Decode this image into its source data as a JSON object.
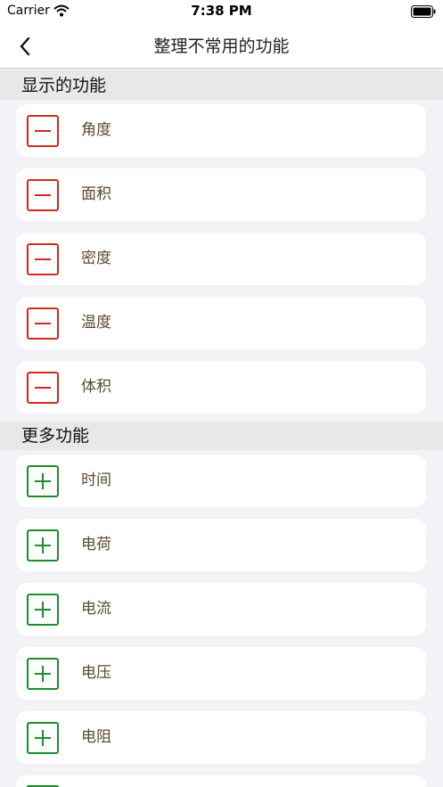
{
  "status_bar": {
    "carrier": "Carrier",
    "time": "7:38 PM",
    "icons": [
      "wifi-icon",
      "battery-icon"
    ]
  },
  "nav": {
    "title": "整理不常用的功能",
    "back_icon": "chevron-left-icon"
  },
  "sections": [
    {
      "title": "显示的功能",
      "icon": "minus-icon",
      "items": [
        {
          "label": "角度"
        },
        {
          "label": "面积"
        },
        {
          "label": "密度"
        },
        {
          "label": "温度"
        },
        {
          "label": "体积"
        }
      ]
    },
    {
      "title": "更多功能",
      "icon": "plus-icon",
      "items": [
        {
          "label": "时间"
        },
        {
          "label": "电荷"
        },
        {
          "label": "电流"
        },
        {
          "label": "电压"
        },
        {
          "label": "电阻"
        }
      ]
    }
  ],
  "colors": {
    "remove": "#d02b20",
    "add": "#1f8a30",
    "label": "#5b4a2e",
    "section_bg": "#e8e8e8",
    "page_bg": "#f2f2f7"
  }
}
